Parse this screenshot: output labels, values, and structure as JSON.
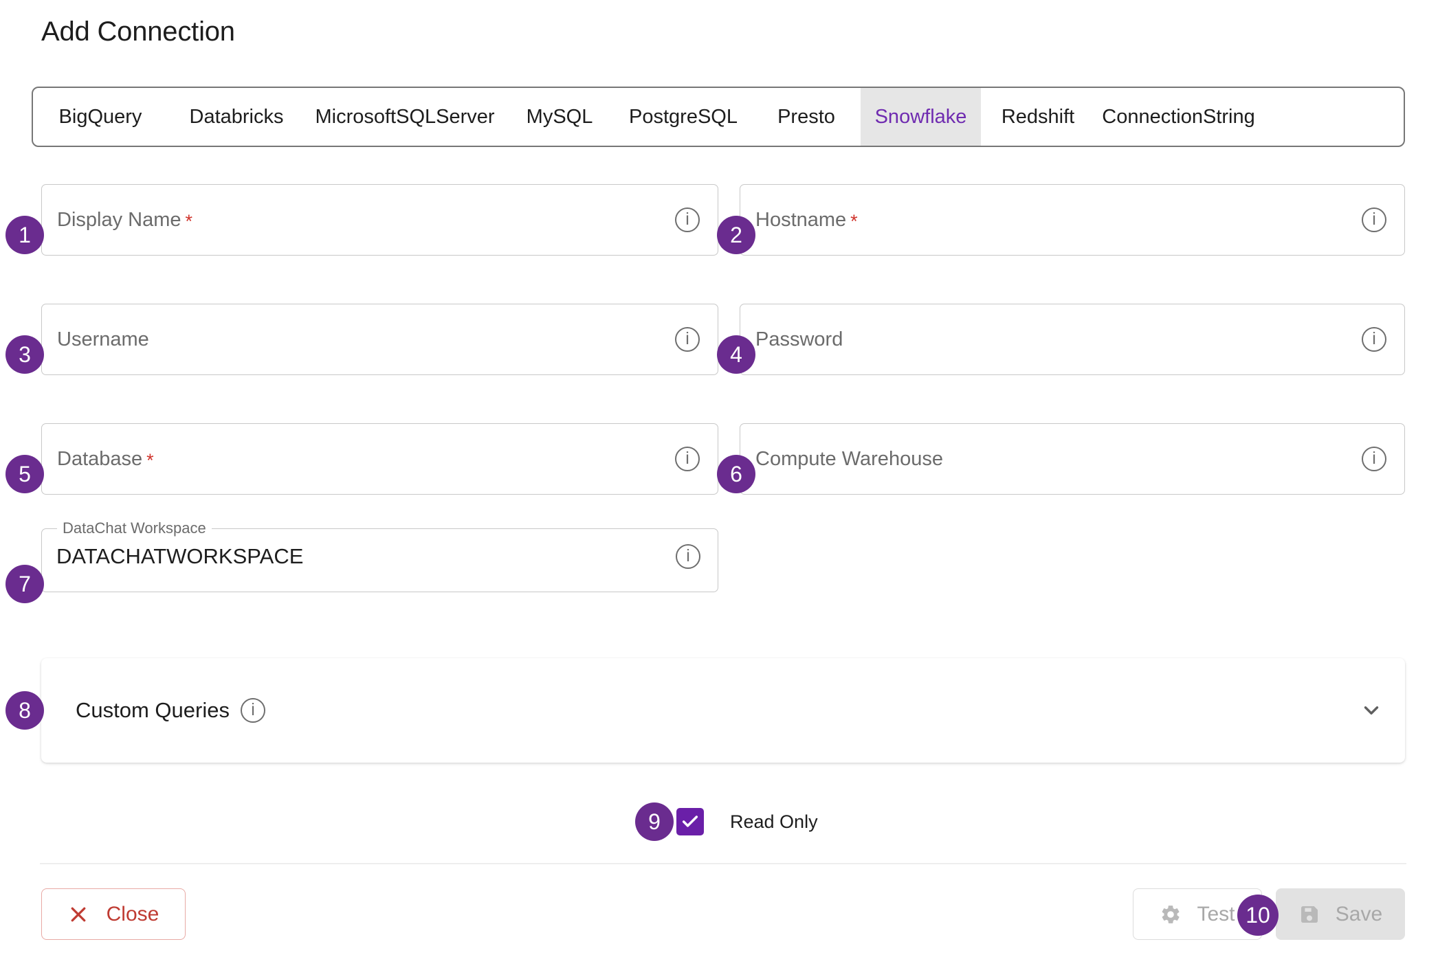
{
  "page": {
    "title": "Add Connection"
  },
  "tabs": {
    "items": [
      {
        "label": "BigQuery",
        "active": false
      },
      {
        "label": "Databricks",
        "active": false
      },
      {
        "label": "MicrosoftSQLServer",
        "active": false
      },
      {
        "label": "MySQL",
        "active": false
      },
      {
        "label": "PostgreSQL",
        "active": false
      },
      {
        "label": "Presto",
        "active": false
      },
      {
        "label": "Snowflake",
        "active": true
      },
      {
        "label": "Redshift",
        "active": false
      },
      {
        "label": "ConnectionString",
        "active": false
      }
    ]
  },
  "form": {
    "fields": [
      {
        "badge": "1",
        "placeholder": "Display Name",
        "required": true,
        "value": "",
        "info": "info-icon"
      },
      {
        "badge": "2",
        "placeholder": "Hostname",
        "required": true,
        "value": "",
        "info": "info-icon"
      },
      {
        "badge": "3",
        "placeholder": "Username",
        "required": false,
        "value": "",
        "info": "info-icon"
      },
      {
        "badge": "4",
        "placeholder": "Password",
        "required": false,
        "value": "",
        "info": "info-icon"
      },
      {
        "badge": "5",
        "placeholder": "Database",
        "required": true,
        "value": "",
        "info": "info-icon"
      },
      {
        "badge": "6",
        "placeholder": "Compute Warehouse",
        "required": false,
        "value": "",
        "info": "info-icon"
      }
    ],
    "workspace": {
      "badge": "7",
      "label": "DataChat Workspace",
      "value": "DATACHATWORKSPACE",
      "info": "info-icon"
    },
    "custom_queries": {
      "badge": "8",
      "label": "Custom Queries",
      "info": "info-icon",
      "expander": "chevron-down-icon",
      "expanded": false
    },
    "read_only": {
      "badge": "9",
      "label": "Read Only",
      "checked": true
    }
  },
  "footer": {
    "close_label": "Close",
    "close_icon": "close-x-icon",
    "test_label": "Test",
    "test_icon": "gear-icon",
    "test_disabled": true,
    "save_label": "Save",
    "save_icon": "save-disk-icon",
    "save_badge": "10",
    "save_disabled": true
  },
  "colors": {
    "badge_purple": "#6a2c8f",
    "active_tab_text": "#6f2bb0",
    "active_tab_bg": "#e6e6e6",
    "checkbox_purple": "#6a1fa8",
    "required_red": "#d0342c",
    "close_red": "#bf3b32",
    "disabled_gray": "#a8a8a8"
  }
}
